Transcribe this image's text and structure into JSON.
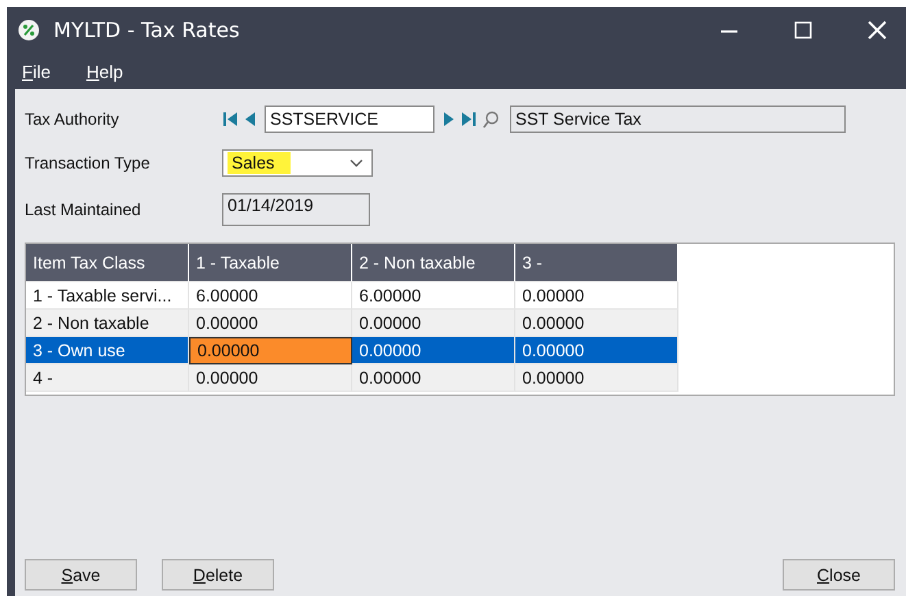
{
  "window": {
    "title": "MYLTD - Tax Rates"
  },
  "menu": [
    {
      "label": "File",
      "underline_first": true
    },
    {
      "label": "Help",
      "underline_first": true
    }
  ],
  "tax_authority": {
    "label": "Tax Authority",
    "value": "SSTSERVICE",
    "description": "SST Service Tax"
  },
  "transaction_type": {
    "label": "Transaction Type",
    "value": "Sales",
    "highlighted": true
  },
  "last_maintained": {
    "label": "Last Maintained",
    "value": "01/14/2019"
  },
  "table": {
    "columns": [
      "Item Tax Class",
      "1 - Taxable",
      "2 - Non taxable",
      "3 -"
    ],
    "rows": [
      {
        "selected": false,
        "cells": [
          {
            "text": "1 - Taxable servi...",
            "focused": false
          },
          {
            "text": "6.00000",
            "focused": false
          },
          {
            "text": "6.00000",
            "focused": false
          },
          {
            "text": "0.00000",
            "focused": false
          }
        ]
      },
      {
        "selected": false,
        "cells": [
          {
            "text": "2 - Non taxable",
            "focused": false
          },
          {
            "text": "0.00000",
            "focused": false
          },
          {
            "text": "0.00000",
            "focused": false
          },
          {
            "text": "0.00000",
            "focused": false
          }
        ]
      },
      {
        "selected": true,
        "cells": [
          {
            "text": "3 - Own use",
            "focused": false
          },
          {
            "text": "0.00000",
            "focused": true
          },
          {
            "text": "0.00000",
            "focused": false
          },
          {
            "text": "0.00000",
            "focused": false
          }
        ]
      },
      {
        "selected": false,
        "cells": [
          {
            "text": "4 -",
            "focused": false
          },
          {
            "text": "0.00000",
            "focused": false
          },
          {
            "text": "0.00000",
            "focused": false
          },
          {
            "text": "0.00000",
            "focused": false
          }
        ]
      }
    ]
  },
  "buttons": [
    "Save",
    "Delete"
  ],
  "close_button": "Close"
}
